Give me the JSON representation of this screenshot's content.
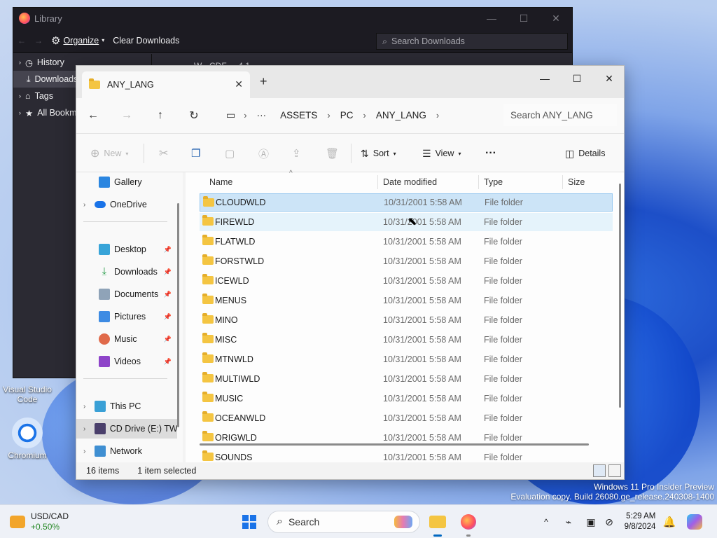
{
  "colors": {
    "accent": "#0067c0",
    "selected_row": "#cce4f7",
    "folder": "#f4c542",
    "stock_up": "#2a8a2a"
  },
  "desktop": {
    "icons": [
      {
        "label": "Visual Studio Code",
        "icon": "vscode-icon"
      },
      {
        "label": "Chromium",
        "icon": "chromium-icon"
      }
    ],
    "watermark": {
      "line1": "Windows 11 Pro Insider Preview",
      "line2": "Evaluation copy. Build 26080.ge_release.240308-1400"
    }
  },
  "library": {
    "title": "Library",
    "toolbar": {
      "organize": "Organize",
      "clear": "Clear Downloads"
    },
    "search_placeholder": "Search Downloads",
    "side": [
      {
        "label": "History"
      },
      {
        "label": "Downloads"
      },
      {
        "label": "Tags"
      },
      {
        "label": "All Bookmarks"
      }
    ],
    "partial_item": "W - CDF ... 4.1"
  },
  "explorer": {
    "tab_title": "ANY_LANG",
    "breadcrumb": [
      "ASSETS",
      "PC",
      "ANY_LANG"
    ],
    "search_placeholder": "Search ANY_LANG",
    "commands": {
      "new": "New",
      "sort": "Sort",
      "view": "View",
      "more": "···",
      "details": "Details"
    },
    "nav": [
      {
        "label": "Gallery",
        "icon": "gallery-icon",
        "pinned": false
      },
      {
        "label": "OneDrive",
        "icon": "onedrive-icon",
        "pinned": false
      },
      {
        "label": "Desktop",
        "icon": "desktop-icon",
        "pinned": true
      },
      {
        "label": "Downloads",
        "icon": "downloads-icon",
        "pinned": true
      },
      {
        "label": "Documents",
        "icon": "documents-icon",
        "pinned": true
      },
      {
        "label": "Pictures",
        "icon": "pictures-icon",
        "pinned": true
      },
      {
        "label": "Music",
        "icon": "music-icon",
        "pinned": true
      },
      {
        "label": "Videos",
        "icon": "videos-icon",
        "pinned": true
      },
      {
        "label": "This PC",
        "icon": "this-pc-icon",
        "pinned": false
      },
      {
        "label": "CD Drive (E:) TW",
        "icon": "cd-drive-icon",
        "pinned": false
      },
      {
        "label": "Network",
        "icon": "network-icon",
        "pinned": false
      }
    ],
    "columns": [
      "Name",
      "Date modified",
      "Type",
      "Size"
    ],
    "rows": [
      {
        "name": "CLOUDWLD",
        "date": "10/31/2001 5:58 AM",
        "type": "File folder"
      },
      {
        "name": "FIREWLD",
        "date": "10/31/2001 5:58 AM",
        "type": "File folder"
      },
      {
        "name": "FLATWLD",
        "date": "10/31/2001 5:58 AM",
        "type": "File folder"
      },
      {
        "name": "FORSTWLD",
        "date": "10/31/2001 5:58 AM",
        "type": "File folder"
      },
      {
        "name": "ICEWLD",
        "date": "10/31/2001 5:58 AM",
        "type": "File folder"
      },
      {
        "name": "MENUS",
        "date": "10/31/2001 5:58 AM",
        "type": "File folder"
      },
      {
        "name": "MINO",
        "date": "10/31/2001 5:58 AM",
        "type": "File folder"
      },
      {
        "name": "MISC",
        "date": "10/31/2001 5:58 AM",
        "type": "File folder"
      },
      {
        "name": "MTNWLD",
        "date": "10/31/2001 5:58 AM",
        "type": "File folder"
      },
      {
        "name": "MULTIWLD",
        "date": "10/31/2001 5:58 AM",
        "type": "File folder"
      },
      {
        "name": "MUSIC",
        "date": "10/31/2001 5:58 AM",
        "type": "File folder"
      },
      {
        "name": "OCEANWLD",
        "date": "10/31/2001 5:58 AM",
        "type": "File folder"
      },
      {
        "name": "ORIGWLD",
        "date": "10/31/2001 5:58 AM",
        "type": "File folder"
      },
      {
        "name": "SOUNDS",
        "date": "10/31/2001 5:58 AM",
        "type": "File folder"
      }
    ],
    "status": {
      "count": "16 items",
      "selection": "1 item selected"
    }
  },
  "taskbar": {
    "stock": {
      "symbol": "USD/CAD",
      "change": "+0.50%"
    },
    "search": "Search",
    "time": "5:29 AM",
    "date": "9/8/2024"
  }
}
